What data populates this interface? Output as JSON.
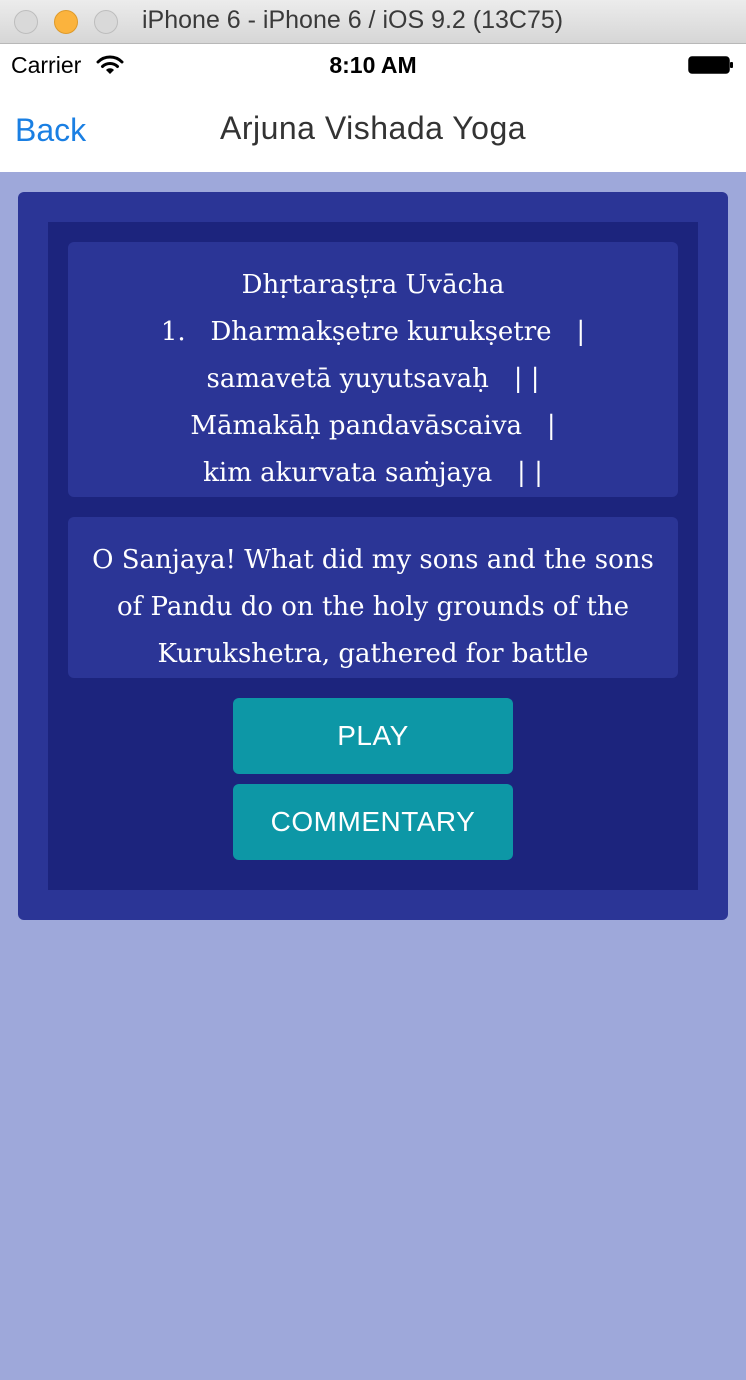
{
  "window": {
    "title": "iPhone 6 - iPhone 6 / iOS 9.2 (13C75)"
  },
  "status_bar": {
    "carrier": "Carrier",
    "time": "8:10 AM",
    "wifi_icon": "wifi-icon",
    "battery_icon": "battery-icon",
    "battery_level": 1.0
  },
  "nav_bar": {
    "back_label": "Back",
    "title": "Arjuna Vishada Yoga"
  },
  "verse": {
    "lines": [
      "Dhṛtaraṣṭra Uvācha",
      "1.   Dharmakṣetre kurukṣetre   |",
      "samavetā yuyutsavaḥ   | |",
      "Māmakāḥ pandavāscaiva   |",
      "kim akurvata saṁjaya   | |"
    ]
  },
  "meaning": {
    "text": "O Sanjaya! What did my sons and the sons of Pandu do on the holy grounds of the Kurukshetra, gathered for battle"
  },
  "buttons": {
    "play_label": "PLAY",
    "commentary_label": "COMMENTARY"
  },
  "colors": {
    "background": "#9ea8da",
    "card_outer": "#2b3596",
    "card_inner": "#1c247d",
    "button": "#0d97a6",
    "link": "#1a7fe3"
  }
}
